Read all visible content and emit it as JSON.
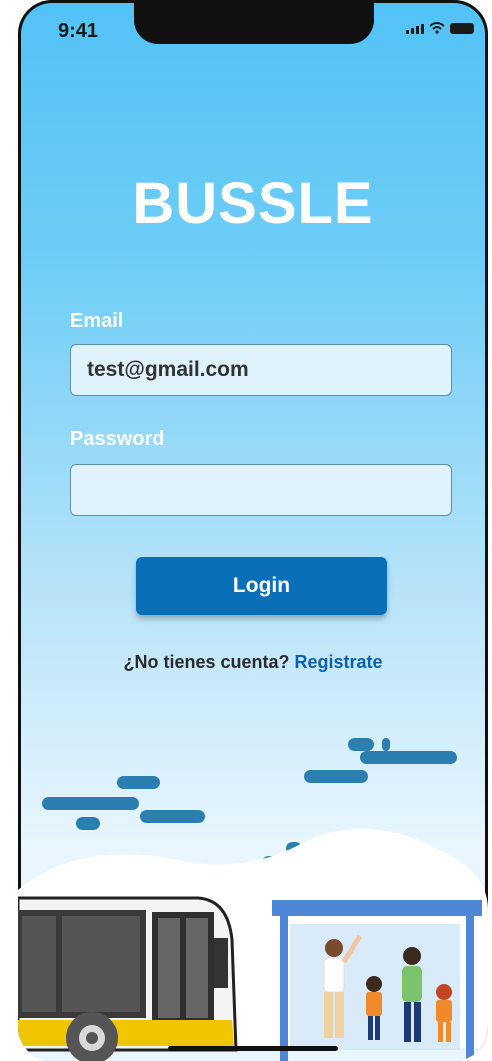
{
  "status_bar": {
    "time": "9:41"
  },
  "app": {
    "brand": "BUSSLE"
  },
  "form": {
    "email_label": "Email",
    "email_value": "test@gmail.com",
    "password_label": "Password",
    "password_value": "",
    "login_label": "Login"
  },
  "footer": {
    "question": "¿No tienes cuenta?",
    "register_link": "Registrate"
  },
  "colors": {
    "sky_top": "#52c2f6",
    "button": "#0a6fb9",
    "link": "#0a62aa",
    "cloud": "#2b7fb0"
  }
}
